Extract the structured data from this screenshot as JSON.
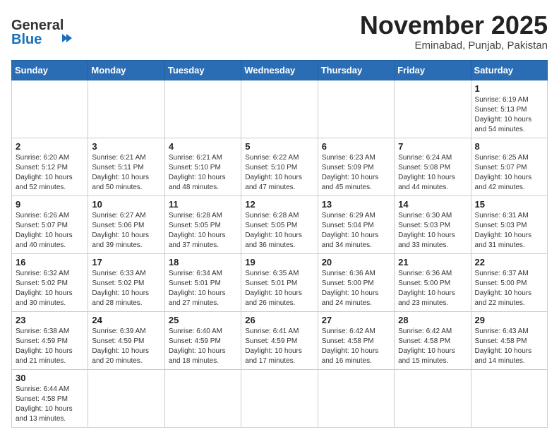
{
  "header": {
    "logo_general": "General",
    "logo_blue": "Blue",
    "title": "November 2025",
    "location": "Eminabad, Punjab, Pakistan"
  },
  "weekdays": [
    "Sunday",
    "Monday",
    "Tuesday",
    "Wednesday",
    "Thursday",
    "Friday",
    "Saturday"
  ],
  "weeks": [
    [
      {
        "day": "",
        "info": ""
      },
      {
        "day": "",
        "info": ""
      },
      {
        "day": "",
        "info": ""
      },
      {
        "day": "",
        "info": ""
      },
      {
        "day": "",
        "info": ""
      },
      {
        "day": "",
        "info": ""
      },
      {
        "day": "1",
        "info": "Sunrise: 6:19 AM\nSunset: 5:13 PM\nDaylight: 10 hours\nand 54 minutes."
      }
    ],
    [
      {
        "day": "2",
        "info": "Sunrise: 6:20 AM\nSunset: 5:12 PM\nDaylight: 10 hours\nand 52 minutes."
      },
      {
        "day": "3",
        "info": "Sunrise: 6:21 AM\nSunset: 5:11 PM\nDaylight: 10 hours\nand 50 minutes."
      },
      {
        "day": "4",
        "info": "Sunrise: 6:21 AM\nSunset: 5:10 PM\nDaylight: 10 hours\nand 48 minutes."
      },
      {
        "day": "5",
        "info": "Sunrise: 6:22 AM\nSunset: 5:10 PM\nDaylight: 10 hours\nand 47 minutes."
      },
      {
        "day": "6",
        "info": "Sunrise: 6:23 AM\nSunset: 5:09 PM\nDaylight: 10 hours\nand 45 minutes."
      },
      {
        "day": "7",
        "info": "Sunrise: 6:24 AM\nSunset: 5:08 PM\nDaylight: 10 hours\nand 44 minutes."
      },
      {
        "day": "8",
        "info": "Sunrise: 6:25 AM\nSunset: 5:07 PM\nDaylight: 10 hours\nand 42 minutes."
      }
    ],
    [
      {
        "day": "9",
        "info": "Sunrise: 6:26 AM\nSunset: 5:07 PM\nDaylight: 10 hours\nand 40 minutes."
      },
      {
        "day": "10",
        "info": "Sunrise: 6:27 AM\nSunset: 5:06 PM\nDaylight: 10 hours\nand 39 minutes."
      },
      {
        "day": "11",
        "info": "Sunrise: 6:28 AM\nSunset: 5:05 PM\nDaylight: 10 hours\nand 37 minutes."
      },
      {
        "day": "12",
        "info": "Sunrise: 6:28 AM\nSunset: 5:05 PM\nDaylight: 10 hours\nand 36 minutes."
      },
      {
        "day": "13",
        "info": "Sunrise: 6:29 AM\nSunset: 5:04 PM\nDaylight: 10 hours\nand 34 minutes."
      },
      {
        "day": "14",
        "info": "Sunrise: 6:30 AM\nSunset: 5:03 PM\nDaylight: 10 hours\nand 33 minutes."
      },
      {
        "day": "15",
        "info": "Sunrise: 6:31 AM\nSunset: 5:03 PM\nDaylight: 10 hours\nand 31 minutes."
      }
    ],
    [
      {
        "day": "16",
        "info": "Sunrise: 6:32 AM\nSunset: 5:02 PM\nDaylight: 10 hours\nand 30 minutes."
      },
      {
        "day": "17",
        "info": "Sunrise: 6:33 AM\nSunset: 5:02 PM\nDaylight: 10 hours\nand 28 minutes."
      },
      {
        "day": "18",
        "info": "Sunrise: 6:34 AM\nSunset: 5:01 PM\nDaylight: 10 hours\nand 27 minutes."
      },
      {
        "day": "19",
        "info": "Sunrise: 6:35 AM\nSunset: 5:01 PM\nDaylight: 10 hours\nand 26 minutes."
      },
      {
        "day": "20",
        "info": "Sunrise: 6:36 AM\nSunset: 5:00 PM\nDaylight: 10 hours\nand 24 minutes."
      },
      {
        "day": "21",
        "info": "Sunrise: 6:36 AM\nSunset: 5:00 PM\nDaylight: 10 hours\nand 23 minutes."
      },
      {
        "day": "22",
        "info": "Sunrise: 6:37 AM\nSunset: 5:00 PM\nDaylight: 10 hours\nand 22 minutes."
      }
    ],
    [
      {
        "day": "23",
        "info": "Sunrise: 6:38 AM\nSunset: 4:59 PM\nDaylight: 10 hours\nand 21 minutes."
      },
      {
        "day": "24",
        "info": "Sunrise: 6:39 AM\nSunset: 4:59 PM\nDaylight: 10 hours\nand 20 minutes."
      },
      {
        "day": "25",
        "info": "Sunrise: 6:40 AM\nSunset: 4:59 PM\nDaylight: 10 hours\nand 18 minutes."
      },
      {
        "day": "26",
        "info": "Sunrise: 6:41 AM\nSunset: 4:59 PM\nDaylight: 10 hours\nand 17 minutes."
      },
      {
        "day": "27",
        "info": "Sunrise: 6:42 AM\nSunset: 4:58 PM\nDaylight: 10 hours\nand 16 minutes."
      },
      {
        "day": "28",
        "info": "Sunrise: 6:42 AM\nSunset: 4:58 PM\nDaylight: 10 hours\nand 15 minutes."
      },
      {
        "day": "29",
        "info": "Sunrise: 6:43 AM\nSunset: 4:58 PM\nDaylight: 10 hours\nand 14 minutes."
      }
    ],
    [
      {
        "day": "30",
        "info": "Sunrise: 6:44 AM\nSunset: 4:58 PM\nDaylight: 10 hours\nand 13 minutes."
      },
      {
        "day": "",
        "info": ""
      },
      {
        "day": "",
        "info": ""
      },
      {
        "day": "",
        "info": ""
      },
      {
        "day": "",
        "info": ""
      },
      {
        "day": "",
        "info": ""
      },
      {
        "day": "",
        "info": ""
      }
    ]
  ]
}
